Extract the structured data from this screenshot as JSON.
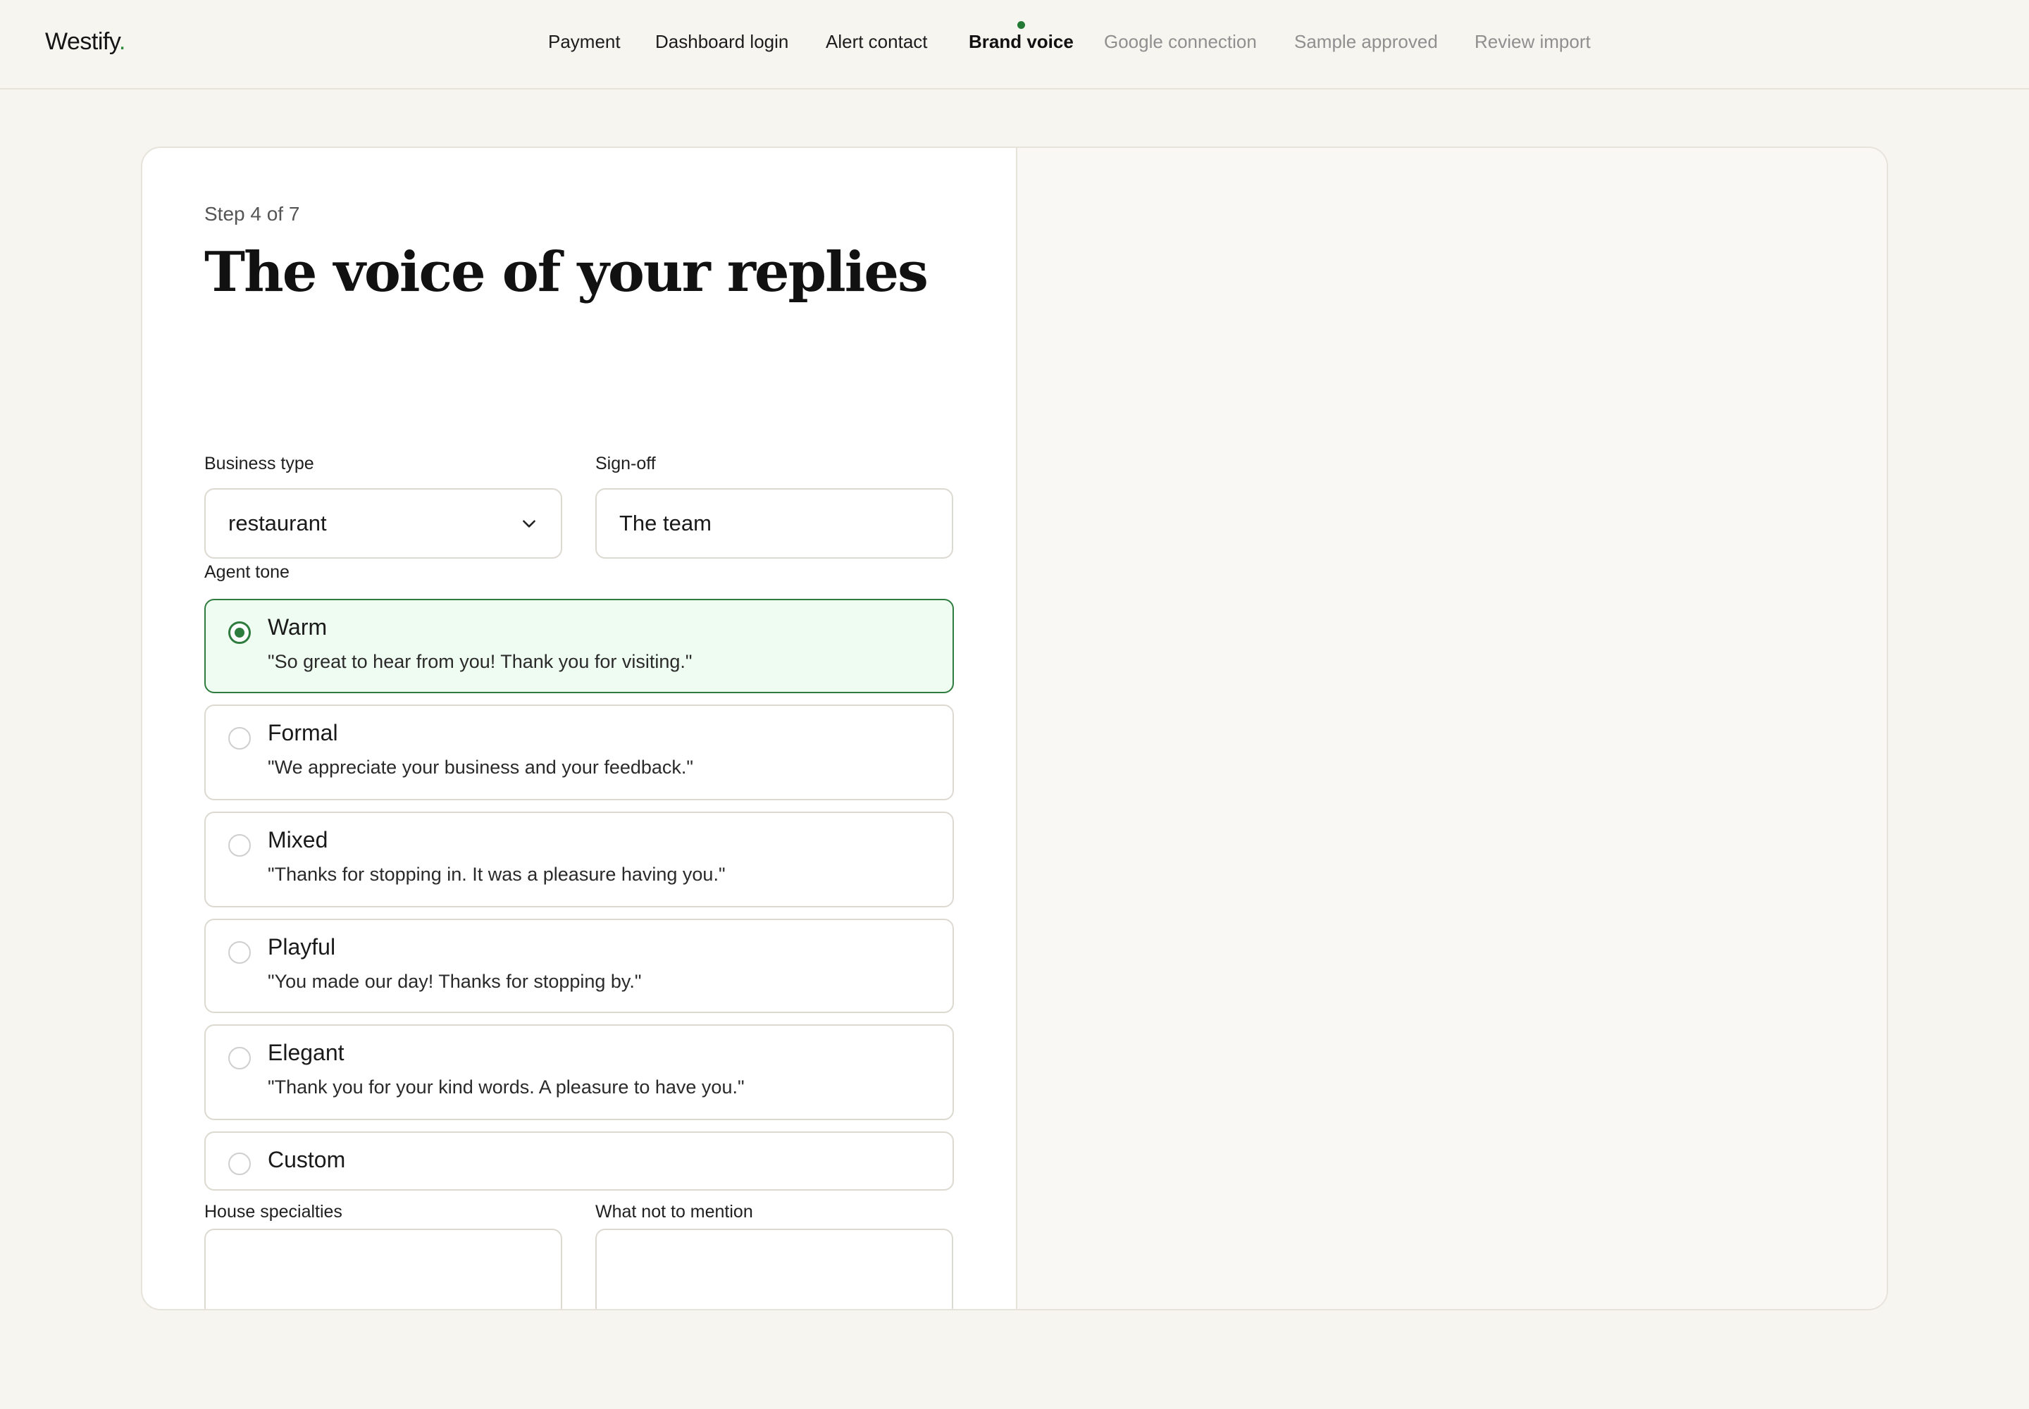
{
  "header": {
    "logo_text": "Westify",
    "logo_dot": ".",
    "accent_color": "#2e7c3e",
    "steps": [
      {
        "label": "Payment",
        "state": "done"
      },
      {
        "label": "Dashboard login",
        "state": "done"
      },
      {
        "label": "Alert contact",
        "state": "done"
      },
      {
        "label": "Brand voice",
        "state": "active"
      },
      {
        "label": "Google connection",
        "state": "future"
      },
      {
        "label": "Sample approved",
        "state": "future"
      },
      {
        "label": "Review import",
        "state": "future"
      }
    ]
  },
  "form": {
    "step_label": "Step 4 of 7",
    "title": "The voice of your replies",
    "business_type": {
      "label": "Business type",
      "value": "restaurant",
      "icon": "chevron-down-icon"
    },
    "sign_off": {
      "label": "Sign-off",
      "value": "The team"
    },
    "agent_tone": {
      "label": "Agent tone",
      "selected": "Warm",
      "options": [
        {
          "name": "Warm",
          "example": "\"So great to hear from you! Thank you for visiting.\""
        },
        {
          "name": "Formal",
          "example": "\"We appreciate your business and your feedback.\""
        },
        {
          "name": "Mixed",
          "example": "\"Thanks for stopping in. It was a pleasure having you.\""
        },
        {
          "name": "Playful",
          "example": "\"You made our day! Thanks for stopping by.\""
        },
        {
          "name": "Elegant",
          "example": "\"Thank you for your kind words. A pleasure to have you.\""
        },
        {
          "name": "Custom",
          "example": ""
        }
      ]
    },
    "house_specialties": {
      "label": "House specialties",
      "value": ""
    },
    "what_not_to_mention": {
      "label": "What not to mention",
      "value": ""
    }
  }
}
